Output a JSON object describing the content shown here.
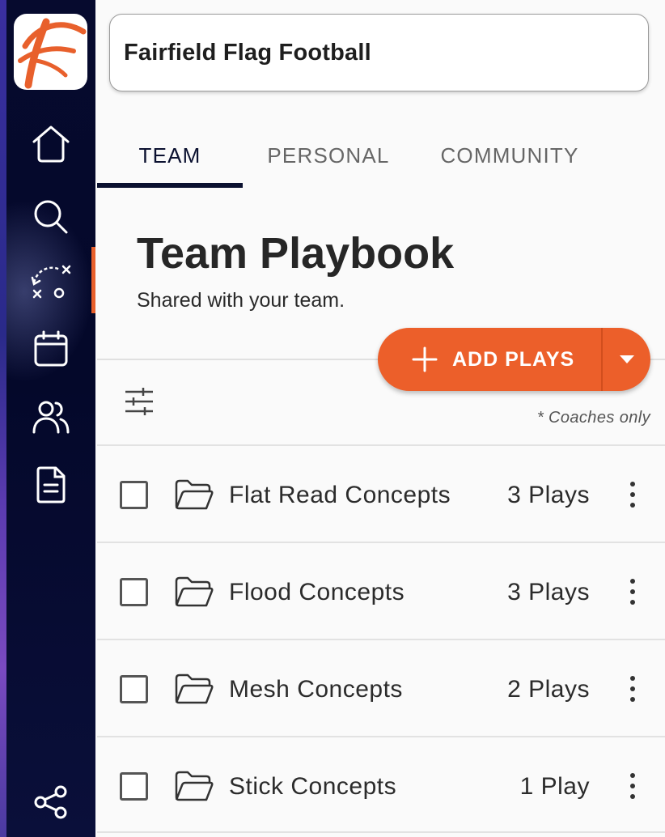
{
  "app": {
    "brand_color": "#ec5f2a",
    "sidebar_color": "#04082a"
  },
  "sidebar": {
    "logo": "fairfield-f-logo",
    "items": [
      {
        "icon": "home-icon"
      },
      {
        "icon": "search-icon"
      },
      {
        "icon": "playbook-icon",
        "active": true
      },
      {
        "icon": "calendar-icon"
      },
      {
        "icon": "users-icon"
      },
      {
        "icon": "document-icon"
      }
    ],
    "share_icon": "share-icon"
  },
  "header": {
    "team_name": "Fairfield Flag Football"
  },
  "tabs": [
    {
      "label": "TEAM",
      "active": true
    },
    {
      "label": "PERSONAL"
    },
    {
      "label": "COMMUNITY"
    }
  ],
  "main": {
    "title": "Team Playbook",
    "subtitle": "Shared with your team.",
    "add_button_label": "ADD PLAYS",
    "coaches_note": "* Coaches only",
    "folders": [
      {
        "name": "Flat Read Concepts",
        "count": "3 Plays"
      },
      {
        "name": "Flood Concepts",
        "count": "3 Plays"
      },
      {
        "name": "Mesh Concepts",
        "count": "2 Plays"
      },
      {
        "name": "Stick Concepts",
        "count": "1 Play"
      }
    ]
  }
}
